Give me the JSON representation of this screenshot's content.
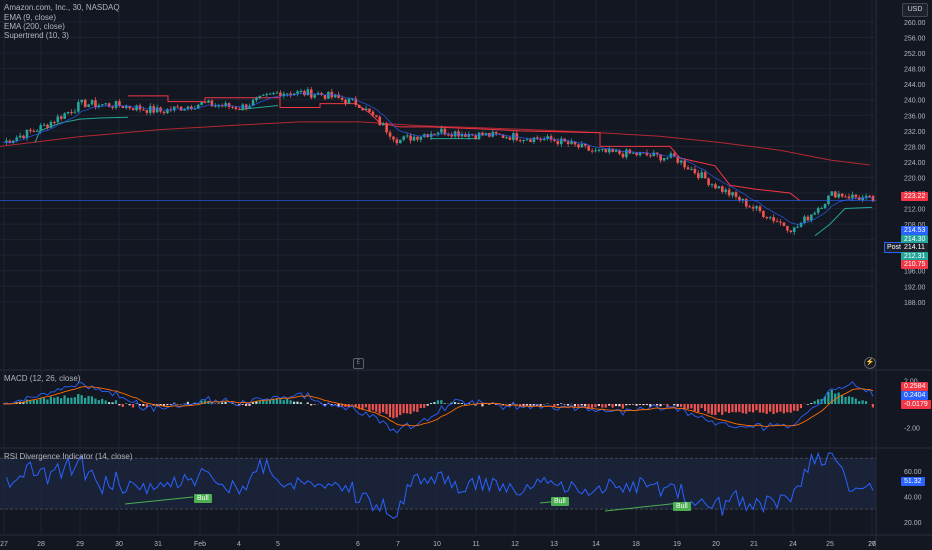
{
  "legend": {
    "symbol": "Amazon.com, Inc., 30, NASDAQ",
    "ema9": "EMA (9, close)",
    "ema200": "EMA (200, close)",
    "supertrend": "Supertrend (10, 3)",
    "macd": "MACD (12, 26, close)",
    "rsi": "RSI Divergence Indicator (14, close)"
  },
  "currency_button": "USD",
  "post_label": "Post",
  "icons": {
    "pane_toggle": "e-icon",
    "alert": "lightning-icon"
  },
  "colors": {
    "background": "#131722",
    "grid": "#1f2330",
    "up": "#26a69a",
    "down": "#ef5350",
    "ema200": "#b22833",
    "supertrend_down_fill": "#3a1b26",
    "supertrend_up_fill": "#13322c",
    "macd_line": "#2962ff",
    "signal_line": "#ff6d00",
    "rsi_line": "#2962ff",
    "rsi_band": "#1e2841",
    "bull_label": "#4caf50"
  },
  "price_axis": {
    "ticks": [
      "260.00",
      "256.00",
      "252.00",
      "248.00",
      "244.00",
      "240.00",
      "236.00",
      "232.00",
      "228.00",
      "224.00",
      "220.00",
      "216.00",
      "212.00",
      "208.00",
      "204.00",
      "200.00",
      "196.00",
      "192.00",
      "188.00"
    ],
    "badges": [
      {
        "label": "223.22",
        "color": "#f23645"
      },
      {
        "label": "214.53",
        "color": "#2962ff"
      },
      {
        "label": "214.30",
        "color": "#26a69a"
      },
      {
        "label": "214.11",
        "color": "#1e222d"
      },
      {
        "label": "212.31",
        "color": "#26a69a"
      },
      {
        "label": "210.75",
        "color": "#f23645"
      }
    ]
  },
  "macd_axis": {
    "ticks": [
      "2.00",
      "-2.00"
    ],
    "badges": [
      {
        "label": "0.2584",
        "color": "#f23645"
      },
      {
        "label": "0.2404",
        "color": "#2962ff"
      },
      {
        "label": "-0.0179",
        "color": "#f23645"
      }
    ]
  },
  "rsi_axis": {
    "ticks": [
      "60.00",
      "40.00",
      "20.00"
    ],
    "badges": [
      {
        "label": "51.32",
        "color": "#2962ff"
      }
    ]
  },
  "rsi_labels": [
    "Bull",
    "Bull",
    "Bull"
  ],
  "time_axis": [
    "27",
    "28",
    "29",
    "30",
    "31",
    "Feb",
    "4",
    "5",
    "6",
    "7",
    "10",
    "11",
    "12",
    "13",
    "14",
    "18",
    "19",
    "20",
    "21",
    "24",
    "25",
    "26",
    "27"
  ],
  "chart_data": {
    "type": "candlestick",
    "title": "Amazon.com, Inc., 30, NASDAQ",
    "ylim": [
      186,
      262
    ],
    "x": [
      "27",
      "28",
      "29",
      "30",
      "31",
      "Feb",
      "4",
      "5",
      "6",
      "7",
      "10",
      "11",
      "12",
      "13",
      "14",
      "18",
      "19",
      "20",
      "21",
      "24",
      "25",
      "26",
      "27"
    ],
    "close_path": [
      [
        0,
        229
      ],
      [
        1,
        233
      ],
      [
        2,
        239
      ],
      [
        3,
        238.5
      ],
      [
        4,
        237
      ],
      [
        5,
        239
      ],
      [
        6,
        238
      ],
      [
        7,
        242
      ],
      [
        8,
        241.5
      ],
      [
        9,
        239
      ],
      [
        10,
        229.5
      ],
      [
        11,
        232
      ],
      [
        12,
        231
      ],
      [
        13,
        230.5
      ],
      [
        14,
        229.5
      ],
      [
        15,
        226.5
      ],
      [
        16,
        226
      ],
      [
        17,
        225
      ],
      [
        18,
        218
      ],
      [
        19,
        212
      ],
      [
        20,
        206.5
      ],
      [
        21,
        216
      ],
      [
        22,
        214.1
      ]
    ],
    "ema9_last": 214.53,
    "ema200_last": 223.22,
    "supertrend_last": 212.31,
    "last_price": 214.11
  }
}
